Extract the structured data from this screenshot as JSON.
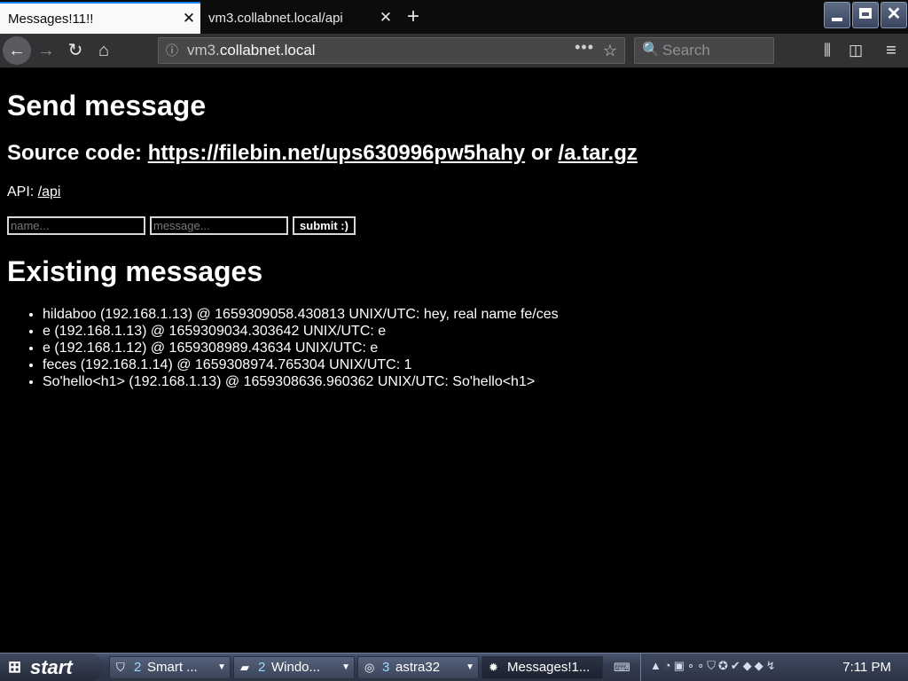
{
  "browser": {
    "tabs": [
      {
        "label": "Messages!11!!",
        "close": "✕"
      },
      {
        "label": "vm3.collabnet.local/api",
        "close": "✕"
      }
    ],
    "new_tab": "+",
    "nav": {
      "back": "←",
      "forward": "→",
      "reload": "↻",
      "home": "⌂"
    },
    "url": {
      "prefix": "vm3.",
      "domain": "collabnet.local",
      "info_icon": "ⓘ",
      "more": "•••",
      "bookmark": "☆"
    },
    "search": {
      "icon": "🔍",
      "placeholder": "Search"
    },
    "toolbar": {
      "library": "⫼",
      "sidebar": "◫",
      "menu": "≡"
    },
    "window_close": "✕"
  },
  "page": {
    "heading": "Send message",
    "source": {
      "prefix": "Source code: ",
      "link1": "https://filebin.net/ups630996pw5hahy",
      "joiner": " or ",
      "link2": "/a.tar.gz"
    },
    "api": {
      "prefix": "API: ",
      "link": "/api"
    },
    "form": {
      "name_placeholder": "name...",
      "message_placeholder": "message...",
      "submit_label": "submit :)"
    },
    "existing_heading": "Existing messages",
    "messages": [
      "hildaboo (192.168.1.13) @ 1659309058.430813 UNIX/UTC: hey, real name fe/ces",
      "e (192.168.1.13) @ 1659309034.303642 UNIX/UTC: e",
      "e (192.168.1.12) @ 1659308989.43634 UNIX/UTC: e",
      "feces (192.168.1.14) @ 1659308974.765304 UNIX/UTC: 1",
      "So'hello<h1> (192.168.1.13) @ 1659308636.960362 UNIX/UTC: So'hello<h1>"
    ]
  },
  "taskbar": {
    "start_label": "start",
    "start_icon": "windows-flag-icon",
    "tasks": [
      {
        "icon": "shield-icon",
        "icon_glyph": "⛉",
        "count": "2",
        "label": "Smart ...",
        "arrow": "▼"
      },
      {
        "icon": "folder-icon",
        "icon_glyph": "▰",
        "count": "2",
        "label": "Windo...",
        "arrow": "▼"
      },
      {
        "icon": "app-icon",
        "icon_glyph": "◎",
        "count": "3",
        "label": "astra32",
        "arrow": "▼"
      },
      {
        "icon": "firefox-icon",
        "icon_glyph": "✹",
        "count": "",
        "label": "Messages!1...",
        "arrow": ""
      }
    ],
    "keyboard_icon": "⌨",
    "tray_icons": "▲◔▣∘∘⛉✪✔◆◆↯",
    "clock": "7:11 PM"
  },
  "colors": {
    "page_background": "#000000",
    "page_text": "#ffffff",
    "tab_accent": "#0a84ff",
    "toolbar": "#323234"
  }
}
